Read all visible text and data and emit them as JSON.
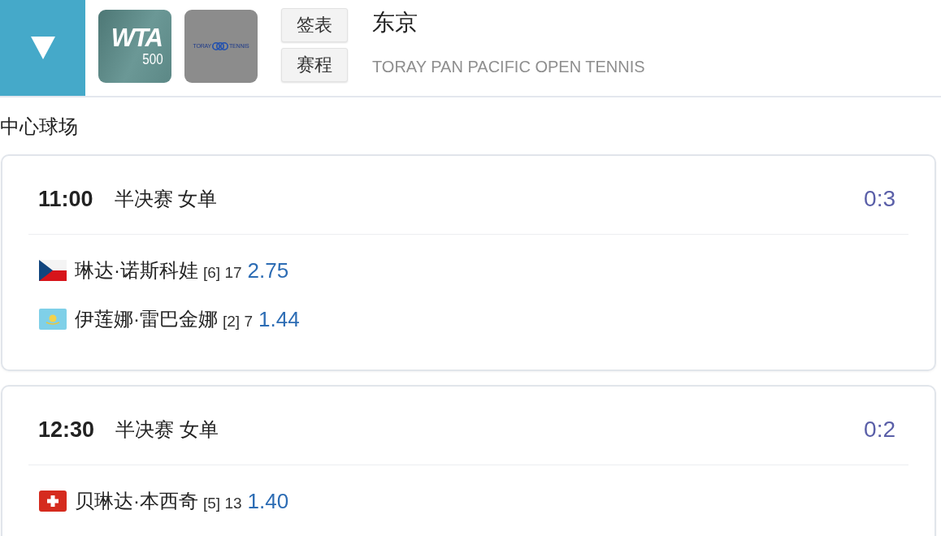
{
  "header": {
    "logos": [
      {
        "kind": "wta",
        "texts": [
          "WTA",
          "500"
        ]
      },
      {
        "kind": "toray",
        "texts": [
          "TORAY",
          "TENNIS"
        ]
      }
    ],
    "buttons": [
      {
        "label": "签表"
      },
      {
        "label": "赛程"
      }
    ],
    "title": "东京",
    "subtitle": "TORAY PAN PACIFIC OPEN TENNIS"
  },
  "court": "中心球场",
  "matches": [
    {
      "time": "11:00",
      "round": "半决赛 女单",
      "score": "0:3",
      "players": [
        {
          "kind": "czech",
          "name": "琳达·诺斯科娃",
          "seed": "[6] 17",
          "odds": "2.75"
        },
        {
          "kind": "kazakh",
          "name": "伊莲娜·雷巴金娜",
          "seed": "[2] 7",
          "odds": "1.44"
        }
      ]
    },
    {
      "time": "12:30",
      "round": "半决赛 女单",
      "score": "0:2",
      "players": [
        {
          "kind": "swiss",
          "name": "贝琳达·本西奇",
          "seed": "[5] 13",
          "odds": "1.40"
        }
      ]
    }
  ]
}
